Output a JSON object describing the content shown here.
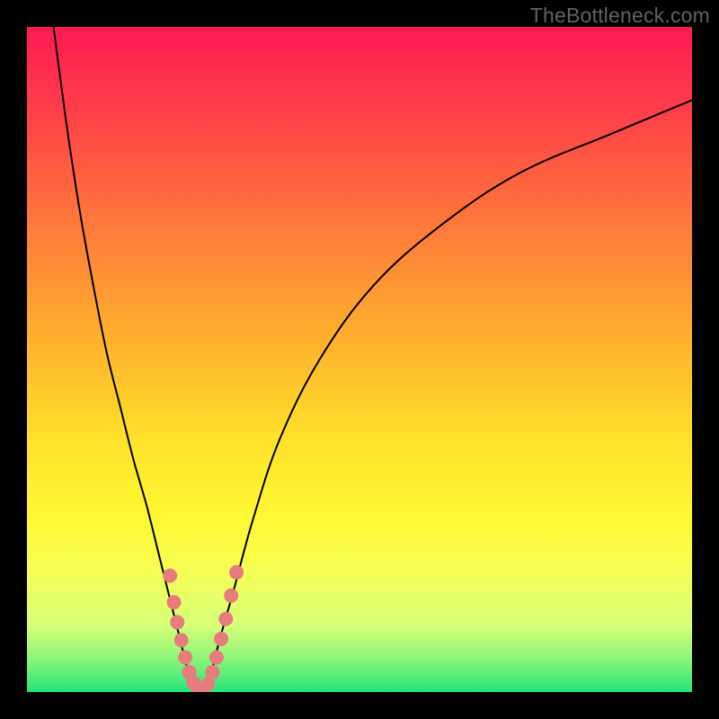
{
  "watermark": "TheBottleneck.com",
  "chart_data": {
    "type": "line",
    "title": "",
    "xlabel": "",
    "ylabel": "",
    "xlim": [
      0,
      100
    ],
    "ylim": [
      0,
      100
    ],
    "gradient_stops": [
      {
        "offset": 0,
        "color": "#ff1a52"
      },
      {
        "offset": 0.12,
        "color": "#ff3d4a"
      },
      {
        "offset": 0.3,
        "color": "#ff7a3a"
      },
      {
        "offset": 0.48,
        "color": "#ffb42d"
      },
      {
        "offset": 0.62,
        "color": "#ffe12a"
      },
      {
        "offset": 0.74,
        "color": "#fff833"
      },
      {
        "offset": 0.82,
        "color": "#f6ff56"
      },
      {
        "offset": 0.9,
        "color": "#d6ff78"
      },
      {
        "offset": 0.95,
        "color": "#8cf57a"
      },
      {
        "offset": 1.0,
        "color": "#23e57a"
      }
    ],
    "series": [
      {
        "name": "left-curve",
        "x": [
          4,
          6,
          8,
          10,
          12,
          14,
          16,
          18,
          20,
          22,
          23,
          24,
          25
        ],
        "y": [
          100,
          85,
          72,
          61,
          51,
          43,
          35,
          28,
          20,
          12,
          8,
          4,
          1
        ]
      },
      {
        "name": "right-curve",
        "x": [
          27,
          28,
          29,
          31,
          34,
          38,
          44,
          52,
          62,
          74,
          88,
          100
        ],
        "y": [
          1,
          4,
          8,
          15,
          26,
          38,
          50,
          61,
          70,
          78,
          84,
          89
        ]
      },
      {
        "name": "trough",
        "x": [
          25,
          25.5,
          26,
          26.5,
          27
        ],
        "y": [
          1,
          0.4,
          0.2,
          0.4,
          1
        ]
      }
    ],
    "markers": {
      "color": "#e77c7c",
      "radius": 8,
      "points": [
        {
          "x": 21.5,
          "y": 17.5
        },
        {
          "x": 22.1,
          "y": 13.5
        },
        {
          "x": 22.6,
          "y": 10.5
        },
        {
          "x": 23.2,
          "y": 7.8
        },
        {
          "x": 23.8,
          "y": 5.2
        },
        {
          "x": 24.4,
          "y": 3.0
        },
        {
          "x": 25.0,
          "y": 1.4
        },
        {
          "x": 25.8,
          "y": 0.5
        },
        {
          "x": 26.5,
          "y": 0.4
        },
        {
          "x": 27.2,
          "y": 1.2
        },
        {
          "x": 27.9,
          "y": 3.0
        },
        {
          "x": 28.5,
          "y": 5.2
        },
        {
          "x": 29.2,
          "y": 8.0
        },
        {
          "x": 29.9,
          "y": 11.0
        },
        {
          "x": 30.7,
          "y": 14.5
        },
        {
          "x": 31.5,
          "y": 18.0
        }
      ]
    }
  }
}
